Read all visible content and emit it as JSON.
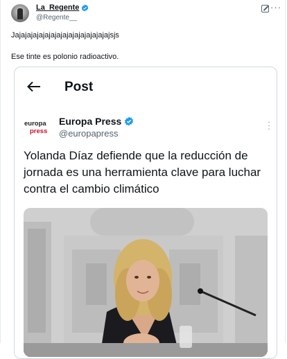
{
  "tweet": {
    "author_name": "La_Regente",
    "author_handle": "@Regente__",
    "text_line1": "Jajajajajajajajajajajajajajajajajsjs",
    "text_line2": "Ese tinte es polonio radioactivo."
  },
  "quoted_screenshot": {
    "nav_title": "Post",
    "source_name": "Europa Press",
    "source_handle": "@europapress",
    "logo_line1": "europa",
    "logo_line2": "press",
    "headline": "Yolanda Díaz defiende que la reducción de jornada es una herramienta clave para luchar contra el cambio climático"
  },
  "colors": {
    "verified_blue": "#1d9bf0",
    "logo_red": "#c8102e",
    "muted_text": "#536471"
  },
  "icons": [
    "verified-badge-icon",
    "grok-icon",
    "more-options-icon",
    "back-arrow-icon"
  ]
}
